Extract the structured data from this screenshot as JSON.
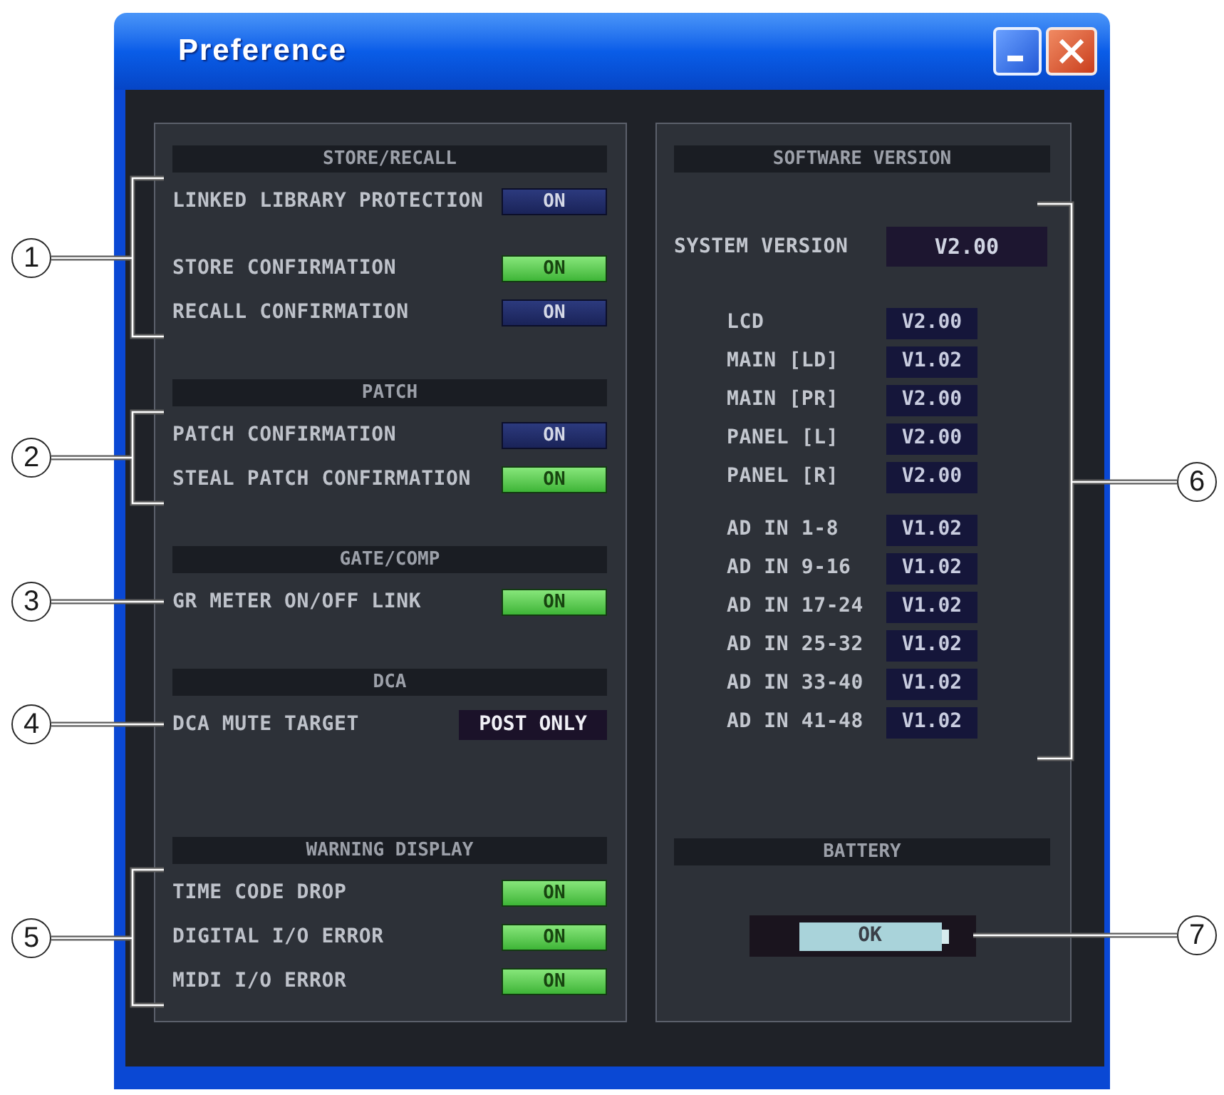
{
  "window": {
    "title": "Preference",
    "controls": [
      {
        "kind": "minimize"
      },
      {
        "kind": "close"
      }
    ]
  },
  "left_panel": {
    "sections": [
      {
        "title": "STORE/RECALL",
        "callout": "1",
        "rows": [
          {
            "kind": "toggle",
            "label": "LINKED LIBRARY PROTECTION",
            "value": "ON",
            "on": false
          },
          {
            "kind": "toggle",
            "label": "STORE CONFIRMATION",
            "value": "ON",
            "on": true
          },
          {
            "kind": "toggle",
            "label": "RECALL CONFIRMATION",
            "value": "ON",
            "on": false
          }
        ]
      },
      {
        "title": "PATCH",
        "callout": "2",
        "rows": [
          {
            "kind": "toggle",
            "label": "PATCH CONFIRMATION",
            "value": "ON",
            "on": false
          },
          {
            "kind": "toggle",
            "label": "STEAL PATCH CONFIRMATION",
            "value": "ON",
            "on": true
          }
        ]
      },
      {
        "title": "GATE/COMP",
        "callout": "3",
        "rows": [
          {
            "kind": "toggle",
            "label": "GR METER ON/OFF LINK",
            "value": "ON",
            "on": true
          }
        ]
      },
      {
        "title": "DCA",
        "callout": "4",
        "rows": [
          {
            "kind": "display",
            "label": "DCA MUTE TARGET",
            "value": "POST ONLY"
          }
        ]
      },
      {
        "title": "WARNING DISPLAY",
        "callout": "5",
        "rows": [
          {
            "kind": "toggle",
            "label": "TIME CODE DROP",
            "value": "ON",
            "on": true
          },
          {
            "kind": "toggle",
            "label": "DIGITAL I/O ERROR",
            "value": "ON",
            "on": true
          },
          {
            "kind": "toggle",
            "label": "MIDI I/O ERROR",
            "value": "ON",
            "on": true
          }
        ]
      }
    ]
  },
  "right_panel": {
    "sections": [
      {
        "kind": "versions",
        "title": "SOFTWARE VERSION",
        "callout": "6",
        "system": {
          "label": "SYSTEM VERSION",
          "value": "V2.00"
        },
        "groups": [
          {
            "rows": [
              {
                "label": "LCD",
                "value": "V2.00"
              },
              {
                "label": "MAIN [LD]",
                "value": "V1.02"
              },
              {
                "label": "MAIN [PR]",
                "value": "V2.00"
              },
              {
                "label": "PANEL [L]",
                "value": "V2.00"
              },
              {
                "label": "PANEL [R]",
                "value": "V2.00"
              }
            ]
          },
          {
            "rows": [
              {
                "label": "AD IN 1-8",
                "value": "V1.02"
              },
              {
                "label": "AD IN 9-16",
                "value": "V1.02"
              },
              {
                "label": "AD IN 17-24",
                "value": "V1.02"
              },
              {
                "label": "AD IN 25-32",
                "value": "V1.02"
              },
              {
                "label": "AD IN 33-40",
                "value": "V1.02"
              },
              {
                "label": "AD IN 41-48",
                "value": "V1.02"
              }
            ]
          }
        ]
      },
      {
        "kind": "battery",
        "title": "BATTERY",
        "callout": "7",
        "status": "OK"
      }
    ]
  }
}
